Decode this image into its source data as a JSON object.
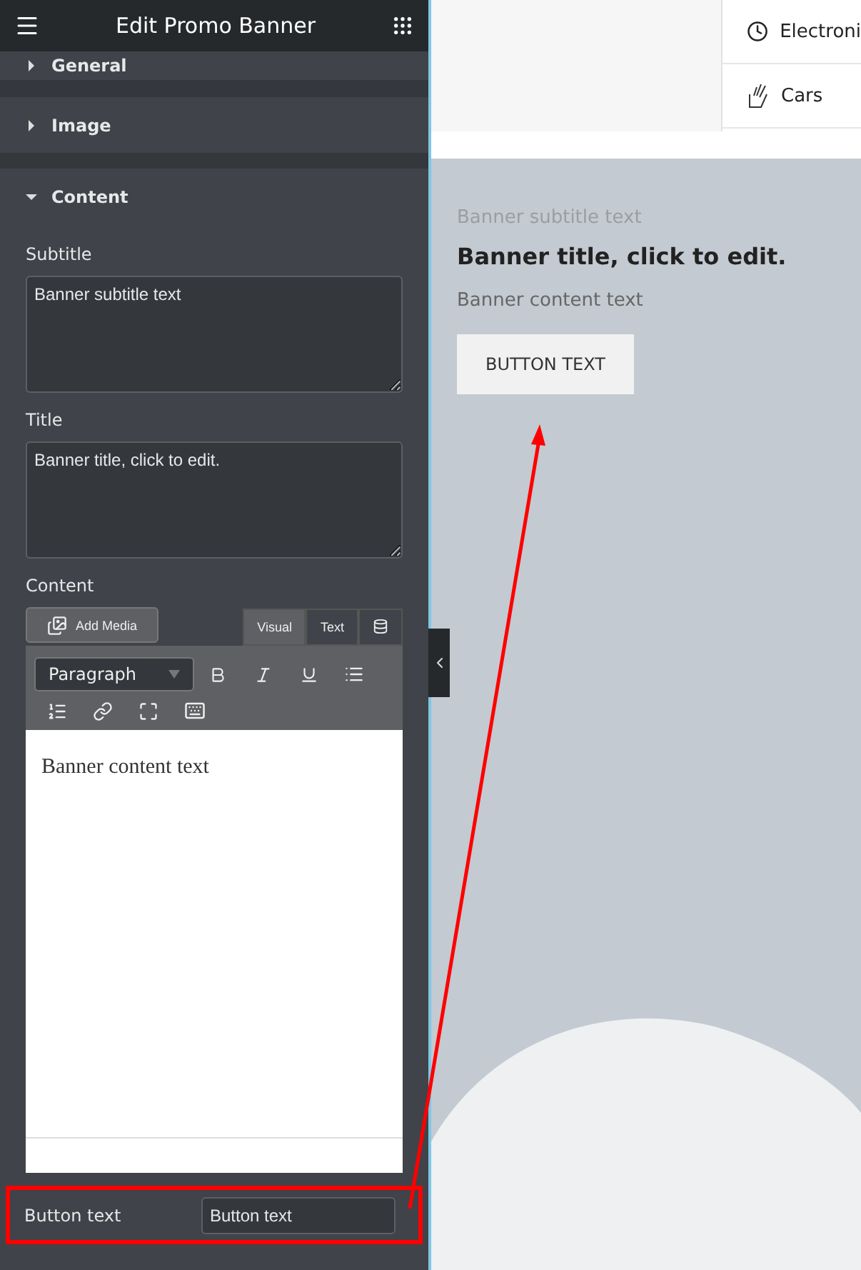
{
  "panel": {
    "title": "Edit Promo Banner"
  },
  "sections": [
    {
      "label": "General",
      "expanded": false
    },
    {
      "label": "Image",
      "expanded": false
    },
    {
      "label": "Content",
      "expanded": true
    }
  ],
  "fields": [
    {
      "label": "Subtitle",
      "value": "Banner subtitle text"
    },
    {
      "label": "Title",
      "value": "Banner title, click to edit."
    }
  ],
  "editor": {
    "label": "Content",
    "add_media": "Add Media",
    "tabs": [
      {
        "label": "Visual",
        "selected": true
      },
      {
        "label": "Text",
        "selected": false
      }
    ],
    "format": "Paragraph",
    "body": "Banner content text"
  },
  "button_field": {
    "label": "Button text",
    "value": "Button text",
    "highlighted": true
  },
  "menu": [
    {
      "label": "Electroni"
    },
    {
      "label": "Cars"
    }
  ],
  "banner": {
    "subtitle": "Banner subtitle text",
    "title": "Banner title, click to edit.",
    "content": "Banner content text",
    "button": "BUTTON TEXT"
  }
}
